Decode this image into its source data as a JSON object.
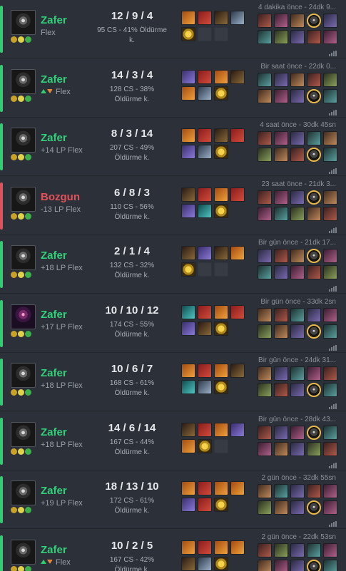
{
  "matches": [
    {
      "result": "Zafer",
      "outcome": "win",
      "champion_icon": "champion-portrait",
      "rank_change": "",
      "rank_trend": "none",
      "queue": "Flex",
      "kda": "12 / 9 / 4",
      "stats_line1": "95 CS - 41% Öldürme",
      "stats_line2": "k.",
      "time": "4 dakika önce - 24dk 9...",
      "items": [
        "orange",
        "red",
        "dark",
        "steel",
        "gold",
        "empty",
        "empty"
      ],
      "team1": [
        "c0",
        "c4",
        "c2",
        "c6",
        "c1"
      ],
      "team2": [
        "c3",
        "c5",
        "c1",
        "c0",
        "c4"
      ],
      "me_team": 1,
      "me_index": 3
    },
    {
      "result": "Zafer",
      "outcome": "win",
      "champion_icon": "champion-portrait",
      "rank_change": "",
      "rank_trend": "up-down",
      "queue": "Flex",
      "kda": "14 / 3 / 4",
      "stats_line1": "128 CS - 38%",
      "stats_line2": "Öldürme k.",
      "time": "Bir saat önce - 22dk 0...",
      "items": [
        "purple",
        "red",
        "orange",
        "dark",
        "orange",
        "steel",
        "gold"
      ],
      "team1": [
        "c3",
        "c1",
        "c2",
        "c0",
        "c5"
      ],
      "team2": [
        "c2",
        "c4",
        "c1",
        "c6",
        "c3"
      ],
      "me_team": 2,
      "me_index": 3
    },
    {
      "result": "Zafer",
      "outcome": "win",
      "champion_icon": "champion-portrait",
      "rank_change": "+14 LP",
      "rank_trend": "none",
      "queue": "Flex",
      "kda": "8 / 3 / 14",
      "stats_line1": "207 CS - 49%",
      "stats_line2": "Öldürme k.",
      "time": "4 saat önce - 30dk 45sn",
      "items": [
        "orange",
        "red",
        "dark",
        "red",
        "purple",
        "steel",
        "gold"
      ],
      "team1": [
        "c0",
        "c4",
        "c1",
        "c3",
        "c2"
      ],
      "team2": [
        "c5",
        "c2",
        "c0",
        "c6",
        "c3"
      ],
      "me_team": 2,
      "me_index": 3
    },
    {
      "result": "Bozgun",
      "outcome": "loss",
      "champion_icon": "champion-portrait",
      "rank_change": "-13 LP",
      "rank_trend": "none",
      "queue": "Flex",
      "kda": "6 / 8 / 3",
      "stats_line1": "110 CS - 56%",
      "stats_line2": "Öldürme k.",
      "time": "23 saat önce - 21dk 3...",
      "items": [
        "dark",
        "red",
        "orange",
        "red",
        "purple",
        "teal",
        "gold"
      ],
      "team1": [
        "c0",
        "c4",
        "c1",
        "c6",
        "c2"
      ],
      "team2": [
        "c4",
        "c3",
        "c5",
        "c2",
        "c0"
      ],
      "me_team": 1,
      "me_index": 3
    },
    {
      "result": "Zafer",
      "outcome": "win",
      "champion_icon": "champion-portrait",
      "rank_change": "+18 LP",
      "rank_trend": "none",
      "queue": "Flex",
      "kda": "2 / 1 / 4",
      "stats_line1": "132 CS - 32%",
      "stats_line2": "Öldürme k.",
      "time": "Bir gün önce - 21dk 17...",
      "items": [
        "dark",
        "purple",
        "dark",
        "orange",
        "gold",
        "empty",
        "empty"
      ],
      "team1": [
        "c1",
        "c0",
        "c2",
        "c6",
        "c4"
      ],
      "team2": [
        "c3",
        "c1",
        "c4",
        "c0",
        "c5"
      ],
      "me_team": 1,
      "me_index": 3
    },
    {
      "result": "Zafer",
      "outcome": "win",
      "champion_icon": "champion-portrait-alt",
      "rank_change": "+17 LP",
      "rank_trend": "none",
      "queue": "Flex",
      "kda": "10 / 10 / 12",
      "stats_line1": "174 CS - 55%",
      "stats_line2": "Öldürme k.",
      "time": "Bir gün önce - 33dk 2sn",
      "items": [
        "teal",
        "red",
        "orange",
        "red",
        "purple",
        "dark",
        "gold"
      ],
      "team1": [
        "c2",
        "c0",
        "c3",
        "c1",
        "c4"
      ],
      "team2": [
        "c5",
        "c2",
        "c1",
        "c6",
        "c3"
      ],
      "me_team": 2,
      "me_index": 3
    },
    {
      "result": "Zafer",
      "outcome": "win",
      "champion_icon": "champion-portrait",
      "rank_change": "+18 LP",
      "rank_trend": "none",
      "queue": "Flex",
      "kda": "10 / 6 / 7",
      "stats_line1": "168 CS - 61%",
      "stats_line2": "Öldürme k.",
      "time": "Bir gün önce - 24dk 31...",
      "items": [
        "orange",
        "red",
        "orange",
        "dark",
        "teal",
        "steel",
        "gold"
      ],
      "team1": [
        "c2",
        "c1",
        "c3",
        "c4",
        "c0"
      ],
      "team2": [
        "c5",
        "c0",
        "c1",
        "c6",
        "c3"
      ],
      "me_team": 2,
      "me_index": 3
    },
    {
      "result": "Zafer",
      "outcome": "win",
      "champion_icon": "champion-portrait",
      "rank_change": "+18 LP",
      "rank_trend": "none",
      "queue": "Flex",
      "kda": "14 / 6 / 14",
      "stats_line1": "167 CS - 44%",
      "stats_line2": "Öldürme k.",
      "time": "Bir gün önce - 28dk 43...",
      "items": [
        "dark",
        "red",
        "orange",
        "purple",
        "orange",
        "gold",
        "empty"
      ],
      "team1": [
        "c0",
        "c1",
        "c4",
        "c6",
        "c3"
      ],
      "team2": [
        "c4",
        "c2",
        "c1",
        "c5",
        "c0"
      ],
      "me_team": 1,
      "me_index": 3
    },
    {
      "result": "Zafer",
      "outcome": "win",
      "champion_icon": "champion-portrait",
      "rank_change": "+19 LP",
      "rank_trend": "none",
      "queue": "Flex",
      "kda": "18 / 13 / 10",
      "stats_line1": "172 CS - 61%",
      "stats_line2": "Öldürme k.",
      "time": "2 gün önce - 32dk 55sn",
      "items": [
        "orange",
        "red",
        "orange",
        "orange",
        "purple",
        "red",
        "gold"
      ],
      "team1": [
        "c2",
        "c3",
        "c1",
        "c0",
        "c4"
      ],
      "team2": [
        "c5",
        "c2",
        "c1",
        "c6",
        "c4"
      ],
      "me_team": 2,
      "me_index": 3
    },
    {
      "result": "Zafer",
      "outcome": "win",
      "champion_icon": "champion-portrait",
      "rank_change": "",
      "rank_trend": "up-down",
      "queue": "Flex",
      "kda": "10 / 2 / 5",
      "stats_line1": "167 CS - 42%",
      "stats_line2": "Öldürme k.",
      "time": "2 gün önce - 22dk 53sn",
      "items": [
        "orange",
        "red",
        "orange",
        "orange",
        "dark",
        "steel",
        "gold"
      ],
      "team1": [
        "c0",
        "c5",
        "c1",
        "c3",
        "c4"
      ],
      "team2": [
        "c2",
        "c4",
        "c1",
        "c6",
        "c3"
      ],
      "me_team": 2,
      "me_index": 3
    }
  ]
}
